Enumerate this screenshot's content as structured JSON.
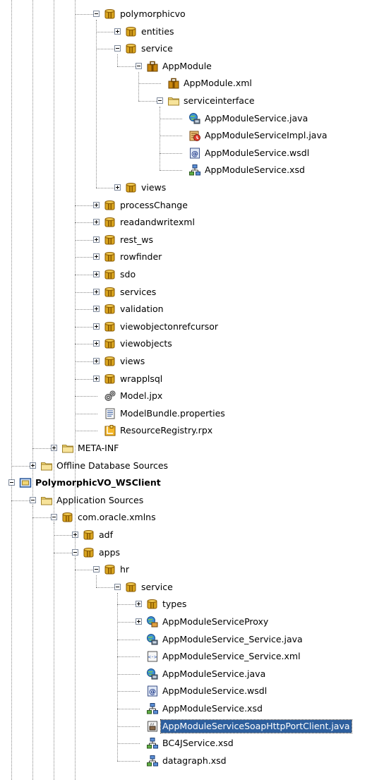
{
  "tree": [
    {
      "depth": 4,
      "label": "polymorphicvo",
      "icon": "package-icon",
      "toggle": "expanded"
    },
    {
      "depth": 5,
      "label": "entities",
      "icon": "package-icon",
      "toggle": "collapsed"
    },
    {
      "depth": 5,
      "label": "service",
      "icon": "package-icon",
      "toggle": "expanded"
    },
    {
      "depth": 6,
      "label": "AppModule",
      "icon": "application-module-icon",
      "toggle": "expanded"
    },
    {
      "depth": 7,
      "label": "AppModule.xml",
      "icon": "application-module-icon"
    },
    {
      "depth": 7,
      "label": "serviceinterface",
      "icon": "folder-icon",
      "toggle": "expanded"
    },
    {
      "depth": 8,
      "label": "AppModuleService.java",
      "icon": "web-service-interface-icon"
    },
    {
      "depth": 8,
      "label": "AppModuleServiceImpl.java",
      "icon": "service-implementation-icon"
    },
    {
      "depth": 8,
      "label": "AppModuleService.wsdl",
      "icon": "wsdl-file-icon"
    },
    {
      "depth": 8,
      "label": "AppModuleService.xsd",
      "icon": "xml-schema-icon"
    },
    {
      "depth": 5,
      "label": "views",
      "icon": "package-icon",
      "toggle": "collapsed"
    },
    {
      "depth": 4,
      "label": "processChange",
      "icon": "package-icon",
      "toggle": "collapsed"
    },
    {
      "depth": 4,
      "label": "readandwritexml",
      "icon": "package-icon",
      "toggle": "collapsed"
    },
    {
      "depth": 4,
      "label": "rest_ws",
      "icon": "package-icon",
      "toggle": "collapsed"
    },
    {
      "depth": 4,
      "label": "rowfinder",
      "icon": "package-icon",
      "toggle": "collapsed"
    },
    {
      "depth": 4,
      "label": "sdo",
      "icon": "package-icon",
      "toggle": "collapsed"
    },
    {
      "depth": 4,
      "label": "services",
      "icon": "package-icon",
      "toggle": "collapsed"
    },
    {
      "depth": 4,
      "label": "validation",
      "icon": "package-icon",
      "toggle": "collapsed"
    },
    {
      "depth": 4,
      "label": "viewobjectonrefcursor",
      "icon": "package-icon",
      "toggle": "collapsed"
    },
    {
      "depth": 4,
      "label": "viewobjects",
      "icon": "package-icon",
      "toggle": "collapsed"
    },
    {
      "depth": 4,
      "label": "views",
      "icon": "package-icon",
      "toggle": "collapsed"
    },
    {
      "depth": 4,
      "label": "wrapplsql",
      "icon": "package-icon",
      "toggle": "collapsed"
    },
    {
      "depth": 4,
      "label": "Model.jpx",
      "icon": "project-settings-icon"
    },
    {
      "depth": 4,
      "label": "ModelBundle.properties",
      "icon": "properties-file-icon"
    },
    {
      "depth": 4,
      "label": "ResourceRegistry.rpx",
      "icon": "resource-registry-icon"
    },
    {
      "depth": 2,
      "label": "META-INF",
      "icon": "folder-icon",
      "toggle": "collapsed"
    },
    {
      "depth": 1,
      "label": "Offline Database Sources",
      "icon": "folder-icon",
      "toggle": "collapsed"
    },
    {
      "depth": 0,
      "label": "PolymorphicVO_WSClient",
      "icon": "project-icon",
      "toggle": "expanded",
      "bold": true
    },
    {
      "depth": 1,
      "label": "Application Sources",
      "icon": "folder-icon",
      "toggle": "expanded"
    },
    {
      "depth": 2,
      "label": "com.oracle.xmlns",
      "icon": "package-icon",
      "toggle": "expanded"
    },
    {
      "depth": 3,
      "label": "adf",
      "icon": "package-icon",
      "toggle": "collapsed"
    },
    {
      "depth": 3,
      "label": "apps",
      "icon": "package-icon",
      "toggle": "expanded"
    },
    {
      "depth": 4,
      "label": "hr",
      "icon": "package-icon",
      "toggle": "expanded"
    },
    {
      "depth": 5,
      "label": "service",
      "icon": "package-icon",
      "toggle": "expanded"
    },
    {
      "depth": 6,
      "label": "types",
      "icon": "package-icon",
      "toggle": "collapsed"
    },
    {
      "depth": 6,
      "label": "AppModuleServiceProxy",
      "icon": "web-service-proxy-icon",
      "toggle": "collapsed"
    },
    {
      "depth": 6,
      "label": "AppModuleService_Service.java",
      "icon": "web-service-interface-icon"
    },
    {
      "depth": 6,
      "label": "AppModuleService_Service.xml",
      "icon": "xml-file-icon"
    },
    {
      "depth": 6,
      "label": "AppModuleService.java",
      "icon": "web-service-interface-icon"
    },
    {
      "depth": 6,
      "label": "AppModuleService.wsdl",
      "icon": "wsdl-file-icon"
    },
    {
      "depth": 6,
      "label": "AppModuleService.xsd",
      "icon": "xml-schema-icon"
    },
    {
      "depth": 6,
      "label": "AppModuleServiceSoapHttpPortClient.java",
      "icon": "java-client-icon",
      "selected": true
    },
    {
      "depth": 6,
      "label": "BC4JService.xsd",
      "icon": "xml-schema-icon"
    },
    {
      "depth": 6,
      "label": "datagraph.xsd",
      "icon": "xml-schema-icon"
    }
  ],
  "colors": {
    "selection": "#2d5f9e",
    "package": "#b8860b",
    "folder": "#f2d774",
    "connector": "#8a8a8a"
  }
}
